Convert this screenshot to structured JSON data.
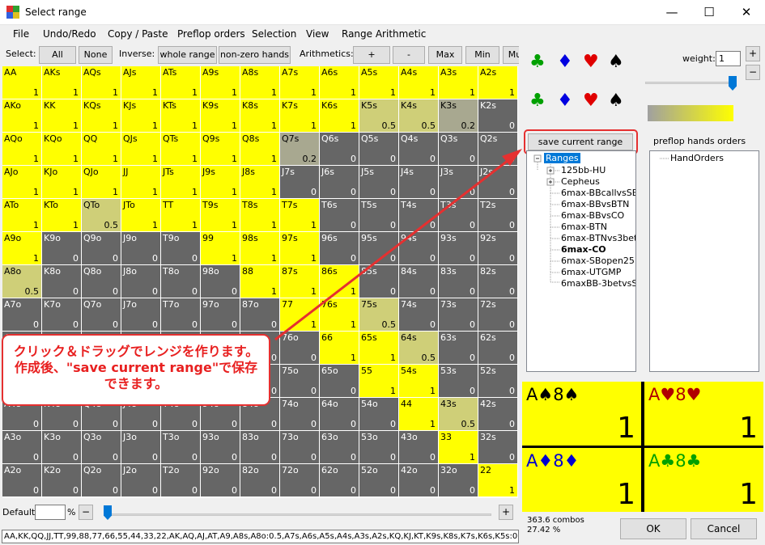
{
  "window": {
    "title": "Select range",
    "minimize": "—",
    "maximize": "☐",
    "close": "✕"
  },
  "menu": [
    "File",
    "Undo/Redo",
    "Copy / Paste",
    "Preflop orders",
    "Selection",
    "View",
    "Range Arithmetic"
  ],
  "toolbar": {
    "select_label": "Select:",
    "all": "All",
    "none": "None",
    "inverse_label": "Inverse:",
    "whole_range": "whole range",
    "non_zero": "non-zero hands",
    "arith_label": "Arithmetics:",
    "plus": "+",
    "minus": "-",
    "max": "Max",
    "min": "Min",
    "mul": "Mu"
  },
  "grid": {
    "rows": [
      [
        "AA",
        "AKs",
        "AQs",
        "AJs",
        "ATs",
        "A9s",
        "A8s",
        "A7s",
        "A6s",
        "A5s",
        "A4s",
        "A3s",
        "A2s"
      ],
      [
        "AKo",
        "KK",
        "KQs",
        "KJs",
        "KTs",
        "K9s",
        "K8s",
        "K7s",
        "K6s",
        "K5s",
        "K4s",
        "K3s",
        "K2s"
      ],
      [
        "AQo",
        "KQo",
        "QQ",
        "QJs",
        "QTs",
        "Q9s",
        "Q8s",
        "Q7s",
        "Q6s",
        "Q5s",
        "Q4s",
        "Q3s",
        "Q2s"
      ],
      [
        "AJo",
        "KJo",
        "QJo",
        "JJ",
        "JTs",
        "J9s",
        "J8s",
        "J7s",
        "J6s",
        "J5s",
        "J4s",
        "J3s",
        "J2s"
      ],
      [
        "ATo",
        "KTo",
        "QTo",
        "JTo",
        "TT",
        "T9s",
        "T8s",
        "T7s",
        "T6s",
        "T5s",
        "T4s",
        "T3s",
        "T2s"
      ],
      [
        "A9o",
        "K9o",
        "Q9o",
        "J9o",
        "T9o",
        "99",
        "98s",
        "97s",
        "96s",
        "95s",
        "94s",
        "93s",
        "92s"
      ],
      [
        "A8o",
        "K8o",
        "Q8o",
        "J8o",
        "T8o",
        "98o",
        "88",
        "87s",
        "86s",
        "85s",
        "84s",
        "83s",
        "82s"
      ],
      [
        "A7o",
        "K7o",
        "Q7o",
        "J7o",
        "T7o",
        "97o",
        "87o",
        "77",
        "76s",
        "75s",
        "74s",
        "73s",
        "72s"
      ],
      [
        "A6o",
        "K6o",
        "Q6o",
        "J6o",
        "T6o",
        "96o",
        "86o",
        "76o",
        "66",
        "65s",
        "64s",
        "63s",
        "62s"
      ],
      [
        "A5o",
        "K5o",
        "Q5o",
        "J5o",
        "T5o",
        "95o",
        "85o",
        "75o",
        "65o",
        "55",
        "54s",
        "53s",
        "52s"
      ],
      [
        "A4o",
        "K4o",
        "Q4o",
        "J4o",
        "T4o",
        "94o",
        "84o",
        "74o",
        "64o",
        "54o",
        "44",
        "43s",
        "42s"
      ],
      [
        "A3o",
        "K3o",
        "Q3o",
        "J3o",
        "T3o",
        "93o",
        "83o",
        "73o",
        "63o",
        "53o",
        "43o",
        "33",
        "32s"
      ],
      [
        "A2o",
        "K2o",
        "Q2o",
        "J2o",
        "T2o",
        "92o",
        "82o",
        "72o",
        "62o",
        "52o",
        "42o",
        "32o",
        "22"
      ]
    ],
    "values": [
      [
        "1",
        "1",
        "1",
        "1",
        "1",
        "1",
        "1",
        "1",
        "1",
        "1",
        "1",
        "1",
        "1"
      ],
      [
        "1",
        "1",
        "1",
        "1",
        "1",
        "1",
        "1",
        "1",
        "1",
        "0.5",
        "0.5",
        "0.2",
        "0"
      ],
      [
        "1",
        "1",
        "1",
        "1",
        "1",
        "1",
        "1",
        "0.2",
        "0",
        "0",
        "0",
        "0",
        "0"
      ],
      [
        "1",
        "1",
        "1",
        "1",
        "1",
        "1",
        "1",
        "0",
        "0",
        "0",
        "0",
        "0",
        "0"
      ],
      [
        "1",
        "1",
        "0.5",
        "1",
        "1",
        "1",
        "1",
        "1",
        "0",
        "0",
        "0",
        "0",
        "0"
      ],
      [
        "1",
        "0",
        "0",
        "0",
        "0",
        "1",
        "1",
        "1",
        "0",
        "0",
        "0",
        "0",
        "0"
      ],
      [
        "0.5",
        "0",
        "0",
        "0",
        "0",
        "0",
        "1",
        "1",
        "1",
        "0",
        "0",
        "0",
        "0"
      ],
      [
        "0",
        "0",
        "0",
        "0",
        "0",
        "0",
        "0",
        "1",
        "1",
        "0.5",
        "0",
        "0",
        "0"
      ],
      [
        "0",
        "0",
        "0",
        "0",
        "0",
        "0",
        "0",
        "0",
        "1",
        "1",
        "0.5",
        "0",
        "0"
      ],
      [
        "0",
        "0",
        "0",
        "0",
        "0",
        "0",
        "0",
        "0",
        "0",
        "1",
        "1",
        "0",
        "0"
      ],
      [
        "0",
        "0",
        "0",
        "0",
        "0",
        "0",
        "0",
        "0",
        "0",
        "0",
        "1",
        "0.5",
        "0"
      ],
      [
        "0",
        "0",
        "0",
        "0",
        "0",
        "0",
        "0",
        "0",
        "0",
        "0",
        "0",
        "1",
        "0"
      ],
      [
        "0",
        "0",
        "0",
        "0",
        "0",
        "0",
        "0",
        "0",
        "0",
        "0",
        "0",
        "0",
        "1"
      ]
    ]
  },
  "callout": {
    "line1": "クリック＆ドラッグでレンジを作ります。",
    "line2": "作成後、\"save current range\"で保存",
    "line3": "できます。"
  },
  "bottom": {
    "default_label": "Default",
    "default_value": "",
    "percent": "%",
    "minus": "−",
    "plus": "+"
  },
  "range_text": "AA,KK,QQ,JJ,TT,99,88,77,66,55,44,33,22,AK,AQ,AJ,AT,A9,A8s,A8o:0.5,A7s,A6s,A5s,A4s,A3s,A2s,KQ,KJ,KT,K9s,K8s,K7s,K6s,K5s:0",
  "suits": {
    "club": "♣",
    "diamond": "♦",
    "heart": "♥",
    "spade": "♠"
  },
  "weight": {
    "label": "weight:",
    "value": "1",
    "plus": "+",
    "minus": "−"
  },
  "save_button": "save current range",
  "tree": {
    "root": "Ranges",
    "items": [
      "125bb-HU",
      "Cepheus",
      "6max-BBcallvsSB",
      "6max-BBvsBTN",
      "6max-BBvsCO",
      "6max-BTN",
      "6max-BTNvs3bet",
      "6max-CO",
      "6max-SBopen25",
      "6max-UTGMP",
      "6maxBB-3betvsSB"
    ]
  },
  "orders": {
    "label": "preflop hands orders",
    "item": "HandOrders"
  },
  "combos_panel": [
    {
      "name": "A♠8♠",
      "value": "1"
    },
    {
      "name": "A♥8♥",
      "value": "1"
    },
    {
      "name": "A♦8♦",
      "value": "1"
    },
    {
      "name": "A♣8♣",
      "value": "1"
    }
  ],
  "stats": {
    "combos": "363.6 combos",
    "percent": "27.42 %"
  },
  "buttons": {
    "ok": "OK",
    "cancel": "Cancel"
  },
  "colors": {
    "full": "#ffff00",
    "partial": "#cfcf78",
    "partial_low": "#a8a890",
    "empty": "#666666",
    "club": "#00a000",
    "diamond": "#0000e0",
    "heart": "#e00000",
    "spade": "#000000",
    "callout": "#e53030"
  }
}
